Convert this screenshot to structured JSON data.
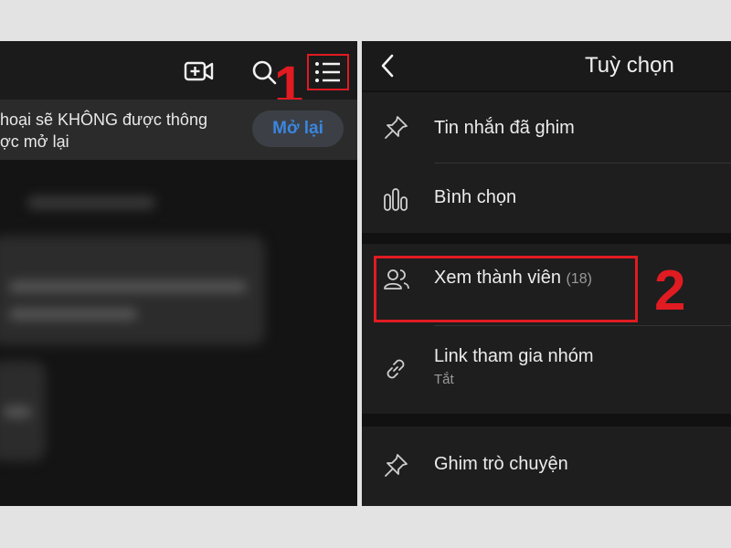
{
  "left_panel": {
    "notice_text": "hoại sẽ KHÔNG được thông\nợc mở lại",
    "reopen_label": "Mở lại",
    "step_number": "1"
  },
  "right_panel": {
    "title": "Tuỳ chọn",
    "options": [
      {
        "label": "Tin nhắn đã ghim",
        "icon": "pin-icon"
      },
      {
        "label": "Bình chọn",
        "icon": "poll-icon"
      },
      {
        "label": "Xem thành viên",
        "count": "(18)",
        "icon": "members-icon"
      },
      {
        "label": "Link tham gia nhóm",
        "sub": "Tắt",
        "icon": "link-icon"
      },
      {
        "label": "Ghim trò chuyện",
        "icon": "pin-icon"
      }
    ],
    "step_number": "2"
  },
  "colors": {
    "annotation_red": "#e01b22",
    "link_blue": "#3a86e0",
    "panel_bg": "#1e1e1e"
  }
}
